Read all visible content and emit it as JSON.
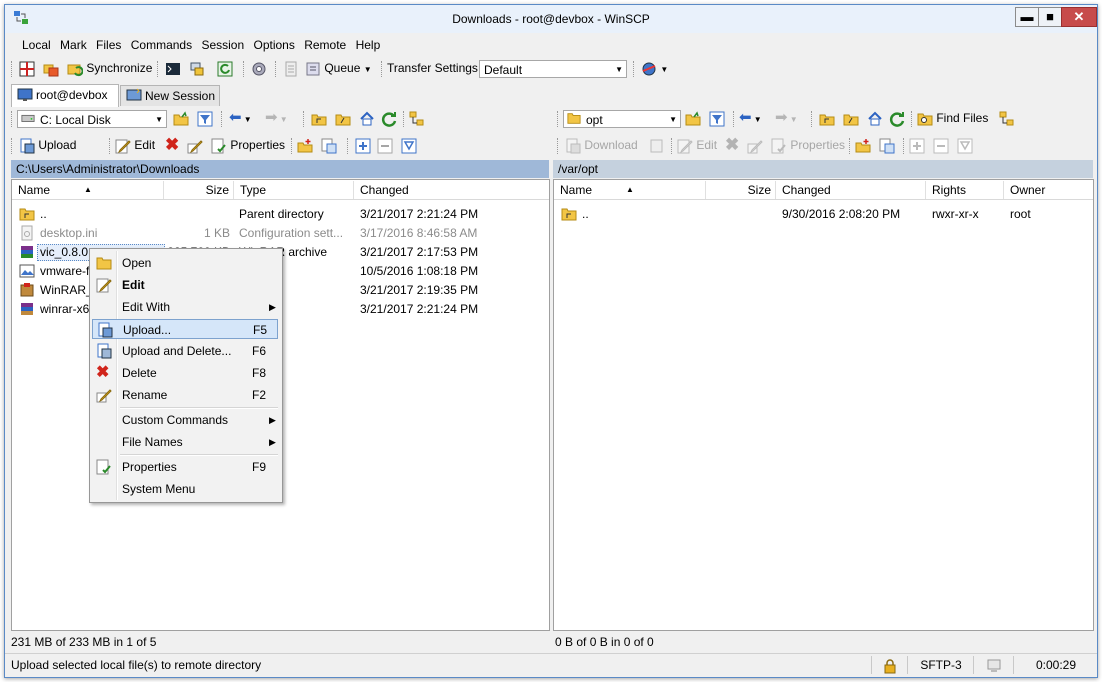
{
  "window": {
    "title": "Downloads - root@devbox - WinSCP",
    "minimize": "▬",
    "maximize": "■",
    "close": "✕"
  },
  "menu": [
    "Local",
    "Mark",
    "Files",
    "Commands",
    "Session",
    "Options",
    "Remote",
    "Help"
  ],
  "toolbar": {
    "synchronize": "Synchronize",
    "queue": "Queue",
    "transfer_settings": "Transfer Settings",
    "transfer_value": "Default"
  },
  "tabs": [
    {
      "label": "root@devbox"
    },
    {
      "label": "New Session"
    }
  ],
  "local": {
    "drive": "C: Local Disk",
    "actions": {
      "upload": "Upload",
      "edit": "Edit",
      "properties": "Properties"
    },
    "path": "C:\\Users\\Administrator\\Downloads",
    "columns": {
      "name": "Name",
      "size": "Size",
      "type": "Type",
      "changed": "Changed"
    },
    "rows": [
      {
        "name": "..",
        "size": "",
        "type": "Parent directory",
        "changed": "3/21/2017   2:21:24 PM"
      },
      {
        "name": "desktop.ini",
        "size": "1 KB",
        "type": "Configuration sett...",
        "changed": "3/17/2016   8:46:58 AM"
      },
      {
        "name": "vic_0.8.0.t",
        "size": "225,760 KB",
        "type": "WinRAR archive",
        "changed": "3/21/2017   2:17:53 PM"
      },
      {
        "name": "vmware-f",
        "size": "",
        "type": "nage",
        "changed": "10/5/2016   1:08:18 PM"
      },
      {
        "name": "WinRAR_5",
        "size": "",
        "type": "tion",
        "changed": "3/21/2017   2:19:35 PM"
      },
      {
        "name": "winrar-x6",
        "size": "",
        "type": "tion",
        "changed": "3/21/2017   2:21:24 PM"
      }
    ],
    "status": "231 MB of 233 MB in 1 of 5"
  },
  "remote": {
    "dir": "opt",
    "find_files": "Find Files",
    "actions": {
      "download": "Download",
      "edit": "Edit",
      "properties": "Properties"
    },
    "path": "/var/opt",
    "columns": {
      "name": "Name",
      "size": "Size",
      "changed": "Changed",
      "rights": "Rights",
      "owner": "Owner"
    },
    "rows": [
      {
        "name": "..",
        "changed": "9/30/2016   2:08:20 PM",
        "rights": "rwxr-xr-x",
        "owner": "root"
      }
    ],
    "status": "0 B of 0 B in 0 of 0"
  },
  "context_menu": {
    "items": [
      {
        "label": "Open",
        "key": ""
      },
      {
        "label": "Edit",
        "key": ""
      },
      {
        "label": "Edit With",
        "key": ""
      },
      {
        "label": "Upload...",
        "key": "F5"
      },
      {
        "label": "Upload and Delete...",
        "key": "F6"
      },
      {
        "label": "Delete",
        "key": "F8"
      },
      {
        "label": "Rename",
        "key": "F2"
      },
      {
        "label": "Custom Commands",
        "key": ""
      },
      {
        "label": "File Names",
        "key": ""
      },
      {
        "label": "Properties",
        "key": "F9"
      },
      {
        "label": "System Menu",
        "key": ""
      }
    ]
  },
  "statusbar": {
    "message": "Upload selected local file(s) to remote directory",
    "protocol": "SFTP-3",
    "time": "0:00:29"
  }
}
